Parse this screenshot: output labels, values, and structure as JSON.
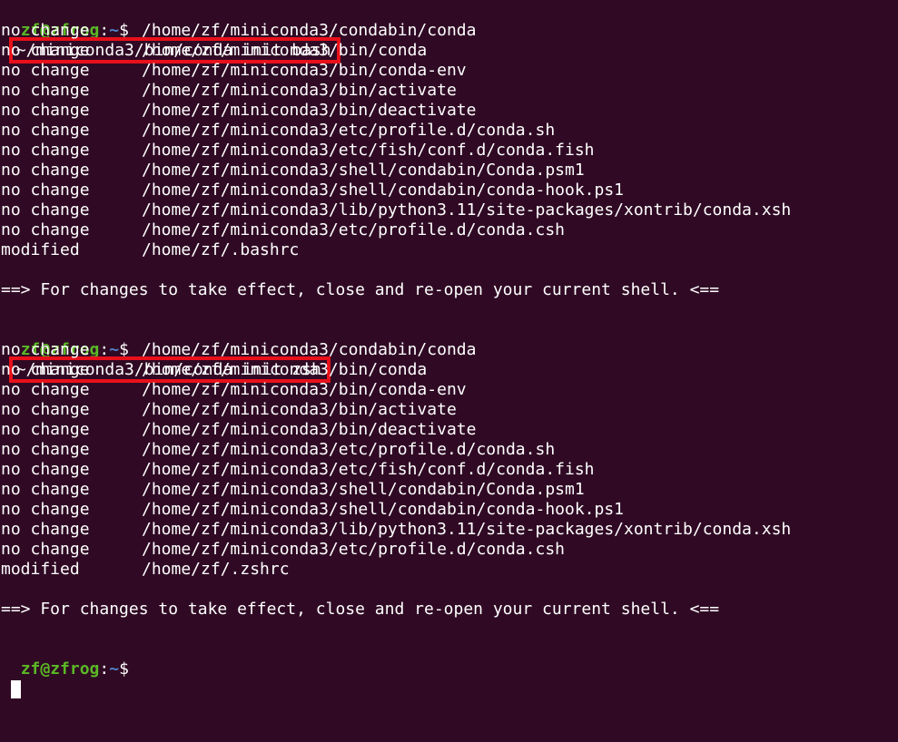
{
  "prompt": {
    "user": "zf@zfrog",
    "colon": ":",
    "path": "~",
    "dollar": "$"
  },
  "blocks": [
    {
      "command": "~/miniconda3/bin/conda init bash",
      "rows": [
        {
          "status": "no change",
          "path": "/home/zf/miniconda3/condabin/conda"
        },
        {
          "status": "no change",
          "path": "/home/zf/miniconda3/bin/conda"
        },
        {
          "status": "no change",
          "path": "/home/zf/miniconda3/bin/conda-env"
        },
        {
          "status": "no change",
          "path": "/home/zf/miniconda3/bin/activate"
        },
        {
          "status": "no change",
          "path": "/home/zf/miniconda3/bin/deactivate"
        },
        {
          "status": "no change",
          "path": "/home/zf/miniconda3/etc/profile.d/conda.sh"
        },
        {
          "status": "no change",
          "path": "/home/zf/miniconda3/etc/fish/conf.d/conda.fish"
        },
        {
          "status": "no change",
          "path": "/home/zf/miniconda3/shell/condabin/Conda.psm1"
        },
        {
          "status": "no change",
          "path": "/home/zf/miniconda3/shell/condabin/conda-hook.ps1"
        },
        {
          "status": "no change",
          "path": "/home/zf/miniconda3/lib/python3.11/site-packages/xontrib/conda.xsh"
        },
        {
          "status": "no change",
          "path": "/home/zf/miniconda3/etc/profile.d/conda.csh"
        },
        {
          "status": "modified",
          "path": "/home/zf/.bashrc"
        }
      ],
      "message": "==> For changes to take effect, close and re-open your current shell. <=="
    },
    {
      "command": "~/miniconda3/bin/conda init zsh",
      "rows": [
        {
          "status": "no change",
          "path": "/home/zf/miniconda3/condabin/conda"
        },
        {
          "status": "no change",
          "path": "/home/zf/miniconda3/bin/conda"
        },
        {
          "status": "no change",
          "path": "/home/zf/miniconda3/bin/conda-env"
        },
        {
          "status": "no change",
          "path": "/home/zf/miniconda3/bin/activate"
        },
        {
          "status": "no change",
          "path": "/home/zf/miniconda3/bin/deactivate"
        },
        {
          "status": "no change",
          "path": "/home/zf/miniconda3/etc/profile.d/conda.sh"
        },
        {
          "status": "no change",
          "path": "/home/zf/miniconda3/etc/fish/conf.d/conda.fish"
        },
        {
          "status": "no change",
          "path": "/home/zf/miniconda3/shell/condabin/Conda.psm1"
        },
        {
          "status": "no change",
          "path": "/home/zf/miniconda3/shell/condabin/conda-hook.ps1"
        },
        {
          "status": "no change",
          "path": "/home/zf/miniconda3/lib/python3.11/site-packages/xontrib/conda.xsh"
        },
        {
          "status": "no change",
          "path": "/home/zf/miniconda3/etc/profile.d/conda.csh"
        },
        {
          "status": "modified",
          "path": "/home/zf/.zshrc"
        }
      ],
      "message": "==> For changes to take effect, close and re-open your current shell. <=="
    }
  ],
  "highlight_color": "#e8101a"
}
